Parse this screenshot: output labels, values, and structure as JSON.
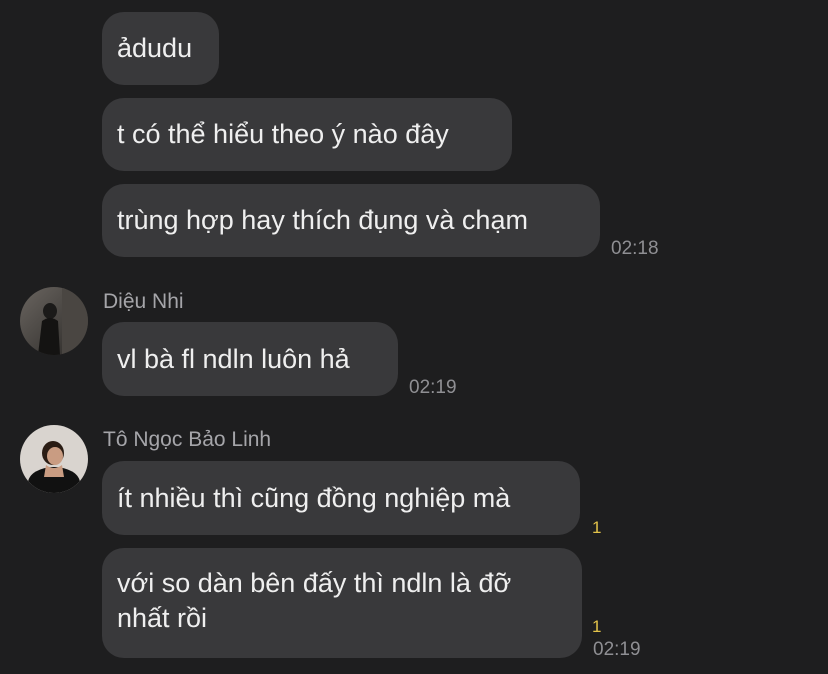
{
  "messages": [
    {
      "text": "ảdudu"
    },
    {
      "text": "t có thể hiểu theo ý nào đây"
    },
    {
      "text": "trùng hợp hay thích đụng và chạm",
      "time": "02:18"
    },
    {
      "sender": "Diệu Nhi",
      "text": "vl bà fl ndln luôn hả",
      "time": "02:19"
    },
    {
      "sender": "Tô Ngọc Bảo Linh",
      "text": "ít nhiều thì cũng đồng nghiệp mà",
      "count": "1"
    },
    {
      "text": "với so dàn bên đấy thì ndln là đỡ nhất rồi",
      "count": "1",
      "time": "02:19"
    }
  ],
  "colors": {
    "background": "#1e1e1f",
    "bubble": "#39393b",
    "timestamp": "#8f8f93",
    "reaction_count": "#e2c24a"
  }
}
